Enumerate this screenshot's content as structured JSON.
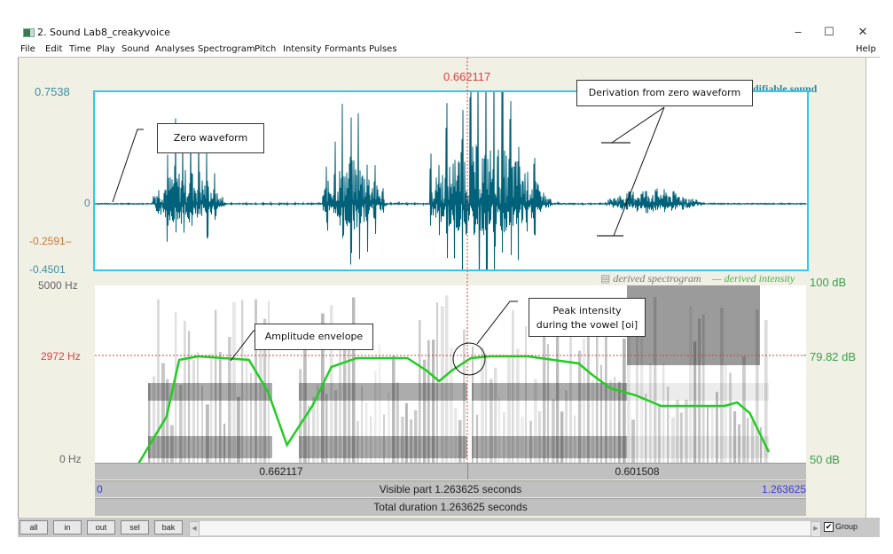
{
  "window": {
    "title": "2. Sound Lab8_creakyvoice",
    "controls": {
      "minimize": "–",
      "maximize": "☐",
      "close": "✕"
    }
  },
  "menu": [
    "File",
    "Edit",
    "Time",
    "Play",
    "Sound",
    "Analyses",
    "Spectrogram",
    "Pitch",
    "Intensity",
    "Formants",
    "Pulses"
  ],
  "help": "Help",
  "cursor_time": "0.662117",
  "waveform": {
    "y_max": "0.7538",
    "y_zero": "0",
    "y_cursor": "-0.2591",
    "y_min": "-0.4501",
    "legend": "modifiable sound"
  },
  "spectrogram": {
    "freq_max": "5000 Hz",
    "freq_cursor": "2972 Hz",
    "freq_min": "0 Hz",
    "legend_spectrogram": "derived spectrogram",
    "legend_intensity": "— derived intensity",
    "db_max": "100 dB",
    "db_cursor": "79.82 dB",
    "db_min": "50 dB"
  },
  "time_bars": {
    "left_segment": "0.662117",
    "right_segment": "0.601508",
    "visible_start": "0",
    "visible_label": "Visible part 1.263625 seconds",
    "visible_end": "1.263625",
    "total_label": "Total duration 1.263625 seconds"
  },
  "annotations": {
    "zero_waveform": "Zero waveform",
    "derivation": "Derivation from zero waveform",
    "amplitude_envelope": "Amplitude envelope",
    "peak_intensity_1": "Peak intensity",
    "peak_intensity_2": "during the vowel [oi]"
  },
  "bottom_buttons": [
    "all",
    "in",
    "out",
    "sel",
    "bak"
  ],
  "group": {
    "label": "Group",
    "checked": true
  },
  "colors": {
    "waveform": "#00627a",
    "wave_border": "#2fc8ee",
    "intensity": "#22cc22",
    "cursor": "#d84040"
  },
  "intensity_curve_db": [
    [
      0.0,
      48
    ],
    [
      0.05,
      63
    ],
    [
      0.07,
      79
    ],
    [
      0.1,
      80
    ],
    [
      0.14,
      79.5
    ],
    [
      0.18,
      79
    ],
    [
      0.21,
      70
    ],
    [
      0.24,
      55
    ],
    [
      0.28,
      66
    ],
    [
      0.31,
      77
    ],
    [
      0.35,
      79.5
    ],
    [
      0.43,
      79.5
    ],
    [
      0.46,
      76
    ],
    [
      0.48,
      73
    ],
    [
      0.5,
      76
    ],
    [
      0.53,
      79.5
    ],
    [
      0.56,
      80
    ],
    [
      0.62,
      80
    ],
    [
      0.66,
      79
    ],
    [
      0.7,
      78
    ],
    [
      0.72,
      75
    ],
    [
      0.75,
      71
    ],
    [
      0.79,
      69
    ],
    [
      0.83,
      66
    ],
    [
      0.88,
      66
    ],
    [
      0.93,
      66
    ],
    [
      0.95,
      67
    ],
    [
      0.97,
      64
    ],
    [
      1.0,
      53
    ]
  ]
}
